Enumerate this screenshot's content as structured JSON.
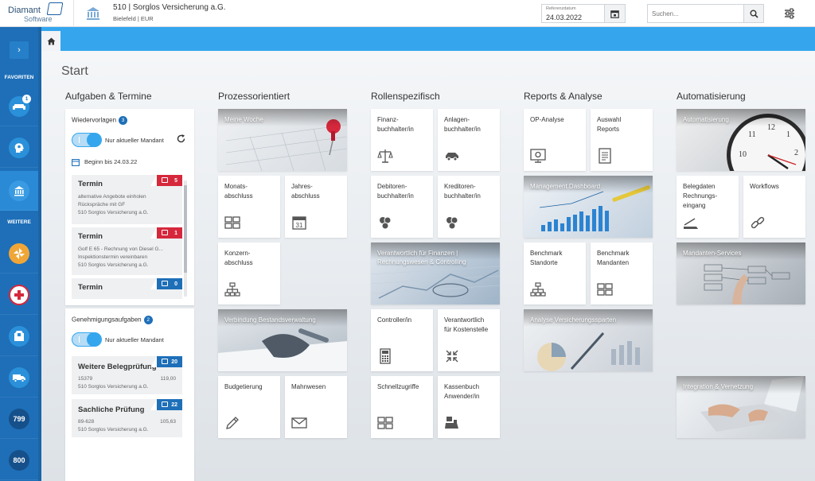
{
  "header": {
    "logo_line1": "Diamant",
    "logo_line2": "Software",
    "mandant_title": "510 | Sorglos Versicherung a.G.",
    "mandant_sub": "Bielefeld | EUR",
    "refdate_label": "Referenzdatum",
    "refdate_value": "24.03.2022",
    "search_placeholder": "Suchen..."
  },
  "sidebar": {
    "favoriten_label": "FAVORITEN",
    "weitere_label": "WEITERE",
    "favorite_badge": "1",
    "num_items": [
      "799",
      "800"
    ]
  },
  "main": {
    "page_title": "Start",
    "columns": {
      "aufgaben": "Aufgaben & Termine",
      "prozess": "Prozessorientiert",
      "rollen": "Rollenspezifisch",
      "reports": "Reports & Analyse",
      "auto": "Automatisierung"
    }
  },
  "wiedervorlagen": {
    "title": "Wiedervorlagen",
    "count": "3",
    "toggle_label": "Nur aktueller Mandant",
    "date_line": "Beginn bis 24.03.22",
    "items": [
      {
        "title": "Termin",
        "count": "5",
        "line1": "alternative Angebote einholen",
        "line2": "Rückspräche mit GF",
        "line3": "510 Sorglos Versicherung a.G."
      },
      {
        "title": "Termin",
        "count": "1",
        "line1": "Golf E 65 - Rechnung von Diesel G...",
        "line2": "Inspektionstermin vereinbaren",
        "line3": "510 Sorglos Versicherung a.G."
      },
      {
        "title": "Termin",
        "count": "0",
        "line1": "",
        "line2": "",
        "line3": ""
      }
    ]
  },
  "genehmigung": {
    "title": "Genehmigungsaufgaben",
    "count": "2",
    "toggle_label": "Nur aktueller Mandant",
    "items": [
      {
        "title": "Weitere Belegprüfung",
        "count": "20",
        "id": "15379",
        "amount": "119,00",
        "mandant": "510 Sorglos Versicherung a.G."
      },
      {
        "title": "Sachliche Prüfung",
        "count": "22",
        "id": "89-628",
        "amount": "105,63",
        "mandant": "510 Sorglos Versicherung a.G."
      }
    ]
  },
  "tiles": {
    "meine_woche": "Meine Woche",
    "monats": "Monats-\nabschluss",
    "jahres": "Jahres-\nabschluss",
    "konzern": "Konzern-\nabschluss",
    "bestand": "Verbindung Bestandsverwaltung",
    "budget": "Budgetierung",
    "mahn": "Mahnwesen",
    "finanz": "Finanz-\nbuchhalter/in",
    "anlagen": "Anlagen-\nbuchhalter/in",
    "debitoren": "Debitoren-\nbuchhalter/in",
    "kreditoren": "Kreditoren-\nbuchhalter/in",
    "verantwortlich": "Verantwortlich für Finanzen |\nRechnungswesen & Controlling",
    "controller": "Controller/in",
    "kostenstelle": "Verantwortlich\nfür Kostenstelle",
    "schnell": "Schnellzugriffe",
    "kassenbuch": "Kassenbuch\nAnwender/in",
    "op": "OP-Analyse",
    "auswahl": "Auswahl\nReports",
    "management": "Management Dashboard",
    "bench_standorte": "Benchmark\nStandorte",
    "bench_mandanten": "Benchmark\nMandanten",
    "analyse": "Analyse Versicherungssparten",
    "automatisierung": "Automatisierung",
    "belegdaten": "Belegdaten\nRechnungs-\neingang",
    "workflows": "Workflows",
    "mandanten_services": "Mandanten-Services",
    "integration": "Integration & Vernetzung"
  }
}
